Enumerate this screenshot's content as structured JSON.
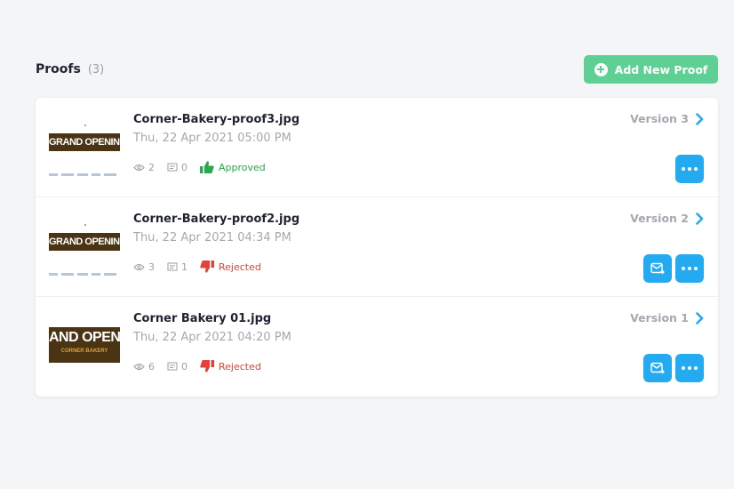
{
  "header": {
    "title": "Proofs",
    "count": "(3)",
    "add_button_label": "Add New Proof"
  },
  "colors": {
    "accent_green": "#5ed093",
    "action_blue": "#23aaf0",
    "approved": "#2aa84a",
    "rejected": "#e0433a"
  },
  "proofs": [
    {
      "filename": "Corner-Bakery-proof3.jpg",
      "date": "Thu, 22 Apr 2021 05:00 PM",
      "views": "2",
      "comments": "0",
      "status": "Approved",
      "status_icon": "thumbs-up-icon",
      "version": "Version 3",
      "thumb_text": "GRAND OPENING",
      "actions": [
        "more-icon"
      ]
    },
    {
      "filename": "Corner-Bakery-proof2.jpg",
      "date": "Thu, 22 Apr 2021 04:34 PM",
      "views": "3",
      "comments": "1",
      "status": "Rejected",
      "status_icon": "thumbs-down-icon",
      "version": "Version 2",
      "thumb_text": "GRAND OPENING",
      "actions": [
        "send-icon",
        "more-icon"
      ]
    },
    {
      "filename": "Corner Bakery 01.jpg",
      "date": "Thu, 22 Apr 2021 04:20 PM",
      "views": "6",
      "comments": "0",
      "status": "Rejected",
      "status_icon": "thumbs-down-icon",
      "version": "Version 1",
      "thumb_text": "AND OPENI",
      "thumb_sub": "CORNER BAKERY",
      "actions": [
        "send-icon",
        "more-icon"
      ]
    }
  ]
}
